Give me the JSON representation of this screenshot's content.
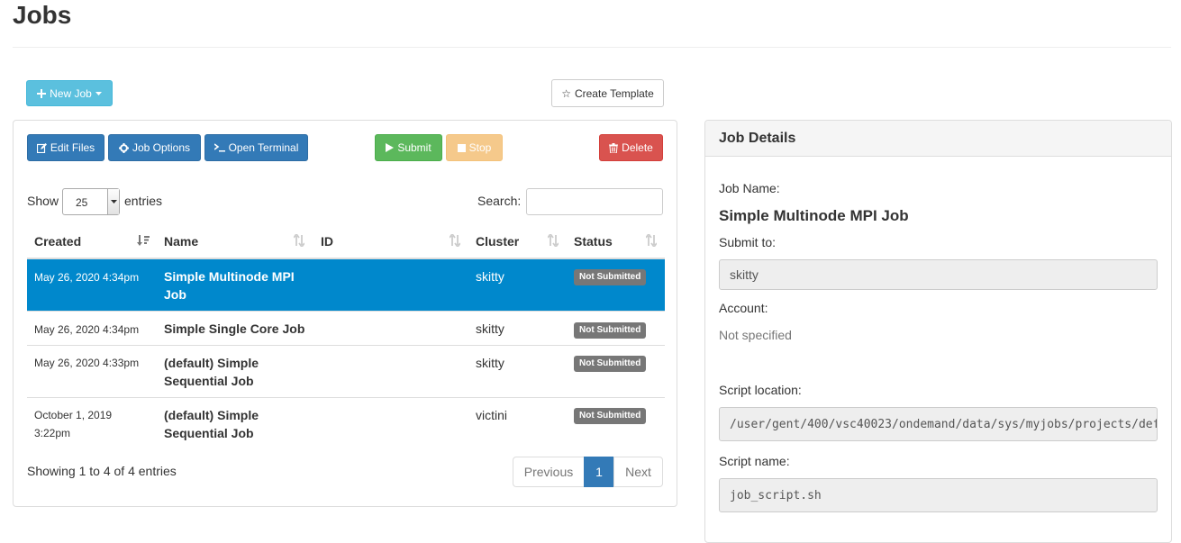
{
  "page": {
    "title": "Jobs"
  },
  "toolbar": {
    "new_job": "New Job",
    "create_template": "Create Template"
  },
  "actions": {
    "edit_files": "Edit Files",
    "job_options": "Job Options",
    "open_terminal": "Open Terminal",
    "submit": "Submit",
    "stop": "Stop",
    "delete": "Delete"
  },
  "table_controls": {
    "show_label": "Show",
    "entries_value": "25",
    "entries_label": "entries",
    "search_label": "Search:",
    "search_value": ""
  },
  "table": {
    "columns": [
      "Created",
      "Name",
      "ID",
      "Cluster",
      "Status"
    ],
    "rows": [
      {
        "created": "May 26, 2020 4:34pm",
        "name": "Simple Multinode MPI Job",
        "id": "",
        "cluster": "skitty",
        "status": "Not Submitted",
        "selected": true
      },
      {
        "created": "May 26, 2020 4:34pm",
        "name": "Simple Single Core Job",
        "id": "",
        "cluster": "skitty",
        "status": "Not Submitted",
        "selected": false
      },
      {
        "created": "May 26, 2020 4:33pm",
        "name": "(default) Simple Sequential Job",
        "id": "",
        "cluster": "skitty",
        "status": "Not Submitted",
        "selected": false
      },
      {
        "created": "October 1, 2019 3:22pm",
        "name": "(default) Simple Sequential Job",
        "id": "",
        "cluster": "victini",
        "status": "Not Submitted",
        "selected": false
      }
    ]
  },
  "pagination": {
    "info": "Showing 1 to 4 of 4 entries",
    "previous": "Previous",
    "current": "1",
    "next": "Next"
  },
  "details": {
    "heading": "Job Details",
    "job_name_label": "Job Name:",
    "job_name": "Simple Multinode MPI Job",
    "submit_to_label": "Submit to:",
    "submit_to": "skitty",
    "account_label": "Account:",
    "account": "Not specified",
    "script_location_label": "Script location:",
    "script_location": "/user/gent/400/vsc40023/ondemand/data/sys/myjobs/projects/def",
    "script_name_label": "Script name:",
    "script_name": "job_script.sh"
  },
  "colors": {
    "primary": "#337ab7",
    "info": "#5bc0de",
    "success": "#5cb85c",
    "warning": "#f0ad4e",
    "danger": "#d9534f",
    "selected_row": "#0088cc",
    "badge": "#777777"
  }
}
